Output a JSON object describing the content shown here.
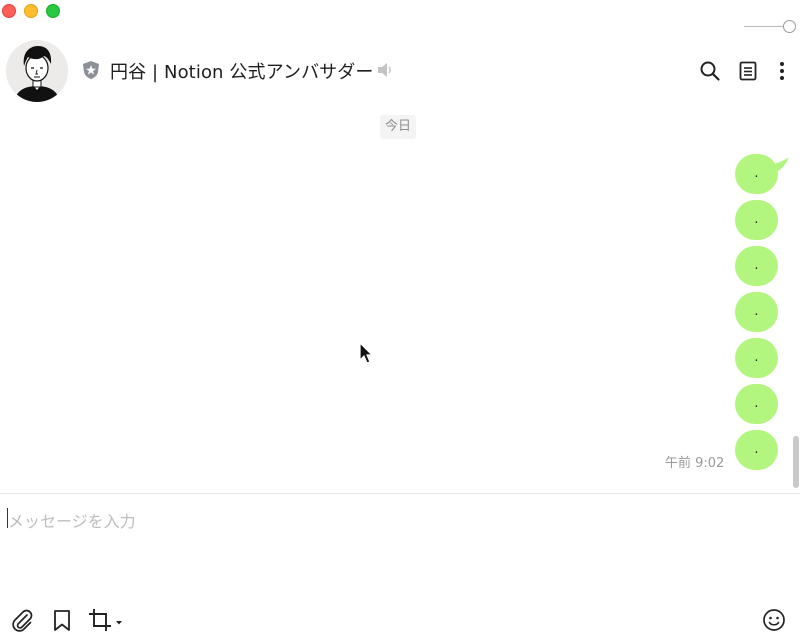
{
  "window": {
    "controls": [
      "close",
      "minimize",
      "maximize"
    ],
    "opacity_level": 1.0
  },
  "header": {
    "avatar_icon": "illustrated-person-avatar",
    "badge_icon": "official-account-shield-icon",
    "title": "円谷 | Notion 公式アンバサダー",
    "mute_icon": "speaker-icon",
    "actions": [
      {
        "name": "search",
        "icon": "search-icon"
      },
      {
        "name": "notes",
        "icon": "notes-icon"
      },
      {
        "name": "more",
        "icon": "more-vertical-icon"
      }
    ]
  },
  "chat": {
    "date_separator": "今日",
    "messages": [
      {
        "text": ".",
        "sender": "me"
      },
      {
        "text": ".",
        "sender": "me"
      },
      {
        "text": ".",
        "sender": "me"
      },
      {
        "text": ".",
        "sender": "me"
      },
      {
        "text": ".",
        "sender": "me"
      },
      {
        "text": ".",
        "sender": "me"
      },
      {
        "text": ".",
        "sender": "me"
      }
    ],
    "last_time": "午前 9:02",
    "bubble_color": "#b2f57f"
  },
  "composer": {
    "placeholder": "メッセージを入力",
    "value": "",
    "tools": [
      {
        "name": "attach",
        "icon": "paperclip-icon"
      },
      {
        "name": "keep",
        "icon": "bookmark-icon"
      },
      {
        "name": "screenshot",
        "icon": "crop-icon"
      }
    ],
    "emoji_icon": "emoji-icon"
  }
}
